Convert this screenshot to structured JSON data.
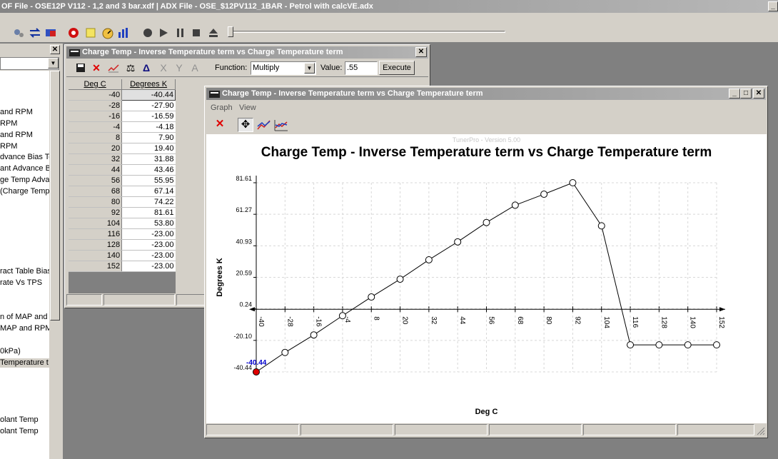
{
  "app": {
    "title": "OF File - OSE12P V112 - 1,2 and 3 bar.xdf | ADX File - OSE_$12PV112_1BAR - Petrol with calcVE.adx"
  },
  "tree_items": [
    {
      "label": "and RPM",
      "selected": false
    },
    {
      "label": "RPM",
      "selected": false
    },
    {
      "label": "and RPM",
      "selected": false
    },
    {
      "label": "RPM",
      "selected": false
    },
    {
      "label": "dvance Bias Ter",
      "selected": false
    },
    {
      "label": "ant Advance B",
      "selected": false
    },
    {
      "label": "ge Temp Advai",
      "selected": false
    },
    {
      "label": "(Charge Temp",
      "selected": false
    },
    {
      "label": "ract Table Bias)",
      "selected": false
    },
    {
      "label": "rate Vs TPS",
      "selected": false
    },
    {
      "label": "n of MAP and R",
      "selected": false
    },
    {
      "label": "MAP and RPM",
      "selected": false
    },
    {
      "label": "0kPa)",
      "selected": false
    },
    {
      "label": "Temperature t",
      "selected": true
    },
    {
      "label": "olant Temp",
      "selected": false
    },
    {
      "label": "olant Temp",
      "selected": false
    }
  ],
  "table_window": {
    "title": "Charge Temp - Inverse Temperature term vs Charge Temperature term",
    "function_label": "Function:",
    "function_value": "Multiply",
    "value_label": "Value:",
    "value_input": ".55",
    "execute_label": "Execute",
    "col_headers": [
      "Deg C",
      "Degrees K"
    ],
    "rows": [
      [
        "-40",
        "-40.44"
      ],
      [
        "-28",
        "-27.90"
      ],
      [
        "-16",
        "-16.59"
      ],
      [
        "-4",
        "-4.18"
      ],
      [
        "8",
        "7.90"
      ],
      [
        "20",
        "19.40"
      ],
      [
        "32",
        "31.88"
      ],
      [
        "44",
        "43.46"
      ],
      [
        "56",
        "55.95"
      ],
      [
        "68",
        "67.14"
      ],
      [
        "80",
        "74.22"
      ],
      [
        "92",
        "81.61"
      ],
      [
        "104",
        "53.80"
      ],
      [
        "116",
        "-23.00"
      ],
      [
        "128",
        "-23.00"
      ],
      [
        "140",
        "-23.00"
      ],
      [
        "152",
        "-23.00"
      ]
    ],
    "selected_row": 0
  },
  "graph_window": {
    "title": "Charge Temp - Inverse Temperature term vs Charge Temperature term",
    "menu": [
      "Graph",
      "View"
    ],
    "version_text": "TunerPro - Version 5.00"
  },
  "chart_data": {
    "type": "line",
    "title": "Charge Temp - Inverse Temperature term vs Charge Temperature term",
    "xlabel": "Deg C",
    "ylabel": "Degrees K",
    "x": [
      -40,
      -28,
      -16,
      -4,
      8,
      20,
      32,
      44,
      56,
      68,
      80,
      92,
      104,
      116,
      128,
      140,
      152
    ],
    "y": [
      -40.44,
      -27.9,
      -16.59,
      -4.18,
      7.9,
      19.4,
      31.88,
      43.46,
      55.95,
      67.14,
      74.22,
      81.61,
      53.8,
      -23.0,
      -23.0,
      -23.0,
      -23.0
    ],
    "xticks": [
      "-40",
      "-28",
      "-16",
      "-4",
      "8",
      "20",
      "32",
      "44",
      "56",
      "68",
      "80",
      "92",
      "104",
      "116",
      "128",
      "140",
      "152"
    ],
    "yticks": [
      "81.61",
      "61.27",
      "40.93",
      "20.59",
      "0.24",
      "-20.10",
      "-40.44"
    ],
    "xlim": [
      -40,
      152
    ],
    "ylim": [
      -40.44,
      81.61
    ],
    "grid": true,
    "highlight_index": 0,
    "highlight_label": "-40.44",
    "colors": {
      "line": "#000000",
      "highlight": "#e00000",
      "highlight_label": "#0000cc"
    }
  }
}
